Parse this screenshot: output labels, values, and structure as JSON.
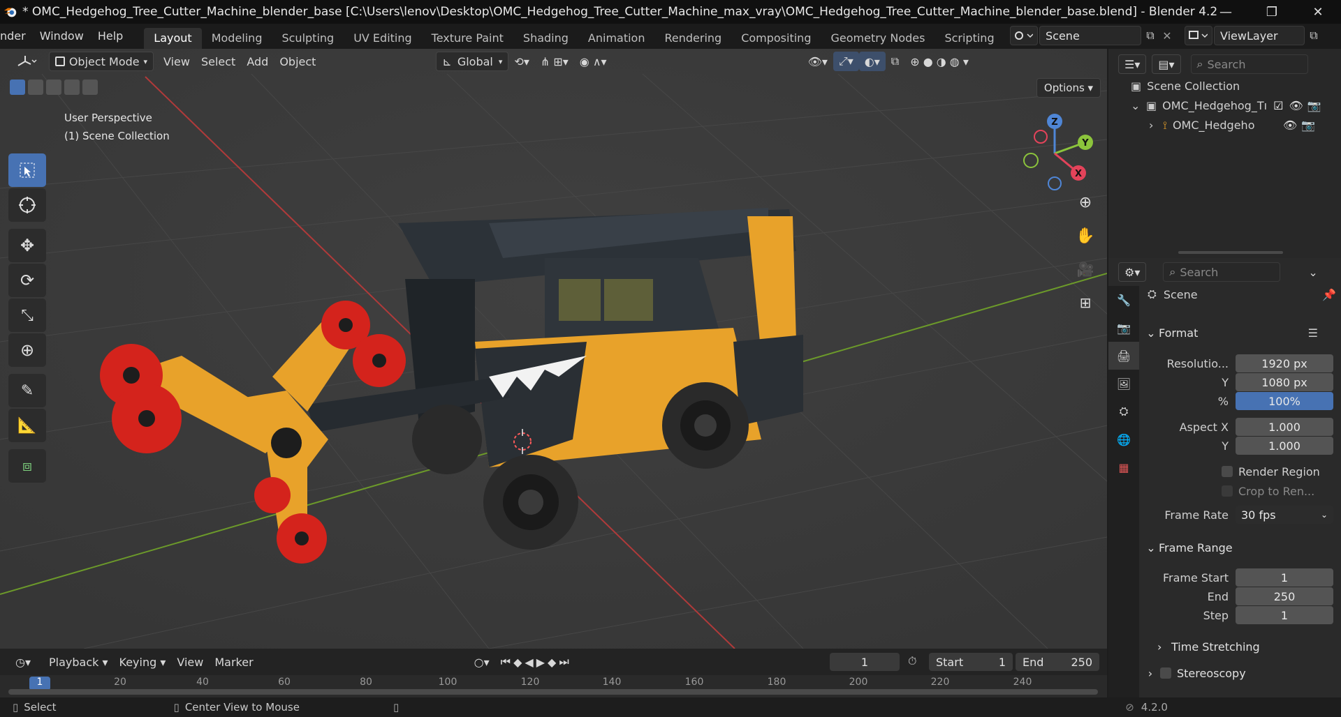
{
  "titlebar": {
    "title": "* OMC_Hedgehog_Tree_Cutter_Machine_blender_base [C:\\Users\\lenov\\Desktop\\OMC_Hedgehog_Tree_Cutter_Machine_max_vray\\OMC_Hedgehog_Tree_Cutter_Machine_blender_base.blend] - Blender 4.2",
    "minimize": "—",
    "maximize": "❐",
    "close": "✕"
  },
  "menu": {
    "items": [
      "nder",
      "Window",
      "Help"
    ]
  },
  "workspaces": {
    "tabs": [
      "Layout",
      "Modeling",
      "Sculpting",
      "UV Editing",
      "Texture Paint",
      "Shading",
      "Animation",
      "Rendering",
      "Compositing",
      "Geometry Nodes",
      "Scripting"
    ],
    "active": "Layout",
    "add": "+"
  },
  "scene_selector": {
    "value": "Scene"
  },
  "viewlayer_selector": {
    "value": "ViewLayer"
  },
  "viewport": {
    "mode": "Object Mode",
    "menus": [
      "View",
      "Select",
      "Add",
      "Object"
    ],
    "transform_orientation": "Global",
    "options_label": "Options",
    "info_line1": "User Perspective",
    "info_line2": "(1) Scene Collection",
    "gizmo": {
      "z": "Z",
      "y": "Y",
      "x": "X"
    }
  },
  "timeline": {
    "menus": [
      "Playback",
      "Keying",
      "View",
      "Marker"
    ],
    "current_frame": "1",
    "start_label": "Start",
    "start_value": "1",
    "end_label": "End",
    "end_value": "250",
    "ruler": [
      "1",
      "20",
      "40",
      "60",
      "80",
      "100",
      "120",
      "140",
      "160",
      "180",
      "200",
      "220",
      "240"
    ]
  },
  "statusbar": {
    "left": "Select",
    "middle": "Center View to Mouse",
    "version": "4.2.0"
  },
  "outliner": {
    "search_placeholder": "Search",
    "root": "Scene Collection",
    "collection": "OMC_Hedgehog_Tı",
    "object": "OMC_Hedgeho"
  },
  "properties": {
    "search_placeholder": "Search",
    "context": "Scene",
    "format_header": "Format",
    "resolution_x_label": "Resolutio...",
    "resolution_x": "1920 px",
    "resolution_y_label": "Y",
    "resolution_y": "1080 px",
    "percent_label": "%",
    "percent": "100%",
    "aspect_x_label": "Aspect X",
    "aspect_x": "1.000",
    "aspect_y_label": "Y",
    "aspect_y": "1.000",
    "render_region": "Render Region",
    "crop": "Crop to Ren...",
    "frame_rate_label": "Frame Rate",
    "frame_rate": "30 fps",
    "frame_range_header": "Frame Range",
    "frame_start_label": "Frame Start",
    "frame_start": "1",
    "end_label": "End",
    "end": "250",
    "step_label": "Step",
    "step": "1",
    "time_stretching": "Time Stretching",
    "stereoscopy": "Stereoscopy"
  },
  "colors": {
    "accent": "#4772b3",
    "machine_yellow": "#e8a22a",
    "wheel_red": "#d4231c"
  }
}
